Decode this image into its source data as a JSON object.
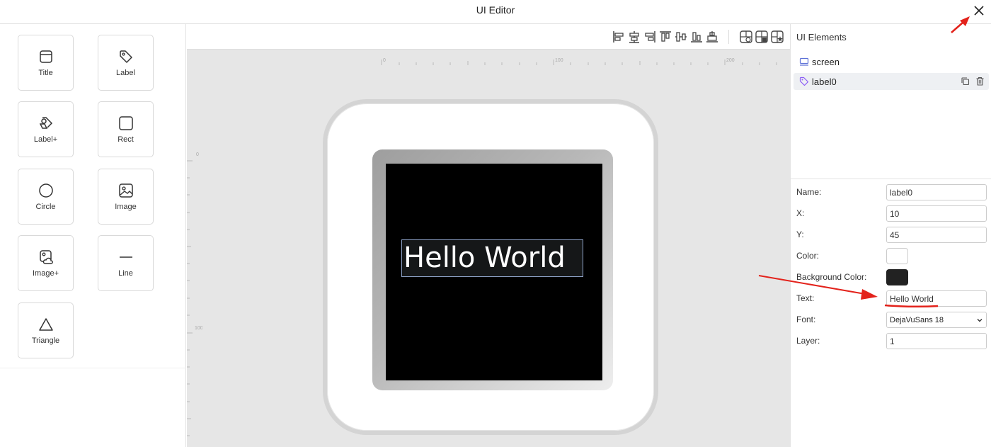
{
  "window": {
    "title": "UI Editor"
  },
  "palette": {
    "items": [
      {
        "label": "Title",
        "icon": "title-icon"
      },
      {
        "label": "Label",
        "icon": "tag-icon"
      },
      {
        "label": "Label+",
        "icon": "tags-icon"
      },
      {
        "label": "Rect",
        "icon": "square-icon"
      },
      {
        "label": "Circle",
        "icon": "circle-icon"
      },
      {
        "label": "Image",
        "icon": "image-icon"
      },
      {
        "label": "Image+",
        "icon": "images-icon"
      },
      {
        "label": "Line",
        "icon": "line-icon"
      },
      {
        "label": "Triangle",
        "icon": "triangle-icon"
      }
    ]
  },
  "canvas": {
    "ruler_top_labels": [
      "0",
      "100",
      "200"
    ],
    "ruler_left_labels": [
      "0",
      "100"
    ],
    "label_text": "Hello World"
  },
  "tree": {
    "title": "UI Elements",
    "items": [
      {
        "label": "screen",
        "icon": "monitor-icon"
      },
      {
        "label": "label0",
        "icon": "tag-icon"
      }
    ]
  },
  "props": {
    "name_label": "Name:",
    "name_value": "label0",
    "x_label": "X:",
    "x_value": "10",
    "y_label": "Y:",
    "y_value": "45",
    "color_label": "Color:",
    "color_value": "#ffffff",
    "bg_label": "Background Color:",
    "bg_value": "#222222",
    "text_label": "Text:",
    "text_value": "Hello World",
    "font_label": "Font:",
    "font_value": "DejaVuSans 18",
    "layer_label": "Layer:",
    "layer_value": "1"
  },
  "colors": {
    "annotation": "#e3221b",
    "accent": "#8b5cf6",
    "tree_icon": "#5b6fd6"
  }
}
